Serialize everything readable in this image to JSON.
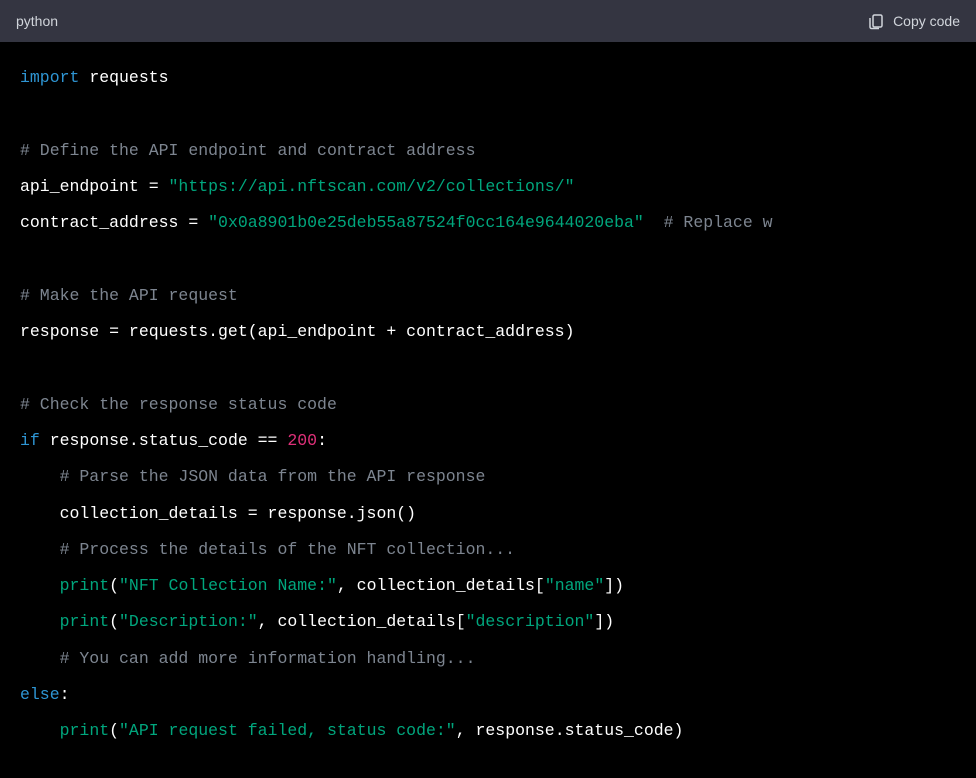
{
  "header": {
    "language": "python",
    "copy_label": "Copy code"
  },
  "code": {
    "l1_kw": "import",
    "l1_mod": " requests",
    "l2": "",
    "l3_cm": "# Define the API endpoint and contract address",
    "l4_var": "api_endpoint = ",
    "l4_str": "\"https://api.nftscan.com/v2/collections/\"",
    "l5_var": "contract_address = ",
    "l5_str": "\"0x0a8901b0e25deb55a87524f0cc164e9644020eba\"",
    "l5_cm": "  # Replace w",
    "l6": "",
    "l7_cm": "# Make the API request",
    "l8": "response = requests.get(api_endpoint + contract_address)",
    "l9": "",
    "l10_cm": "# Check the response status code",
    "l11_kw": "if",
    "l11_a": " response.status_code == ",
    "l11_num": "200",
    "l11_b": ":",
    "l12_cm": "    # Parse the JSON data from the API response",
    "l13": "    collection_details = response.json()",
    "l14_cm": "    # Process the details of the NFT collection...",
    "l15_pre": "    ",
    "l15_fn": "print",
    "l15_a": "(",
    "l15_str": "\"NFT Collection Name:\"",
    "l15_b": ", collection_details[",
    "l15_key": "\"name\"",
    "l15_c": "])",
    "l16_pre": "    ",
    "l16_fn": "print",
    "l16_a": "(",
    "l16_str": "\"Description:\"",
    "l16_b": ", collection_details[",
    "l16_key": "\"description\"",
    "l16_c": "])",
    "l17_cm": "    # You can add more information handling...",
    "l18_kw": "else",
    "l18_a": ":",
    "l19_pre": "    ",
    "l19_fn": "print",
    "l19_a": "(",
    "l19_str": "\"API request failed, status code:\"",
    "l19_b": ", response.status_code)"
  }
}
